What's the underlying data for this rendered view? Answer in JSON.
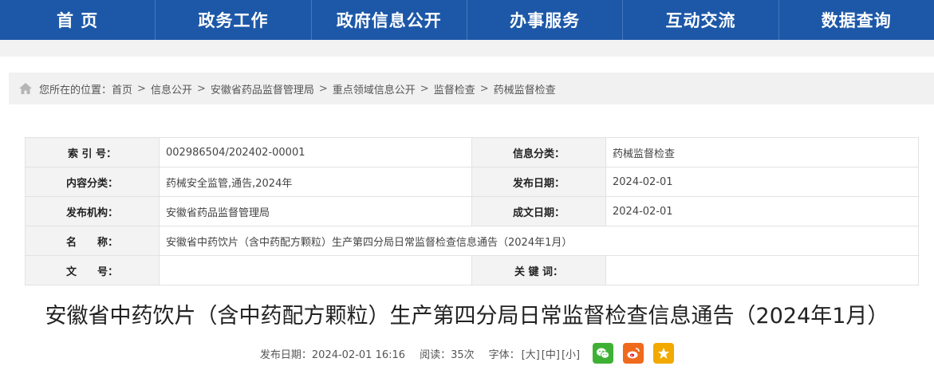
{
  "nav": {
    "items": [
      "首 页",
      "政务工作",
      "政府信息公开",
      "办事服务",
      "互动交流",
      "数据查询"
    ]
  },
  "breadcrumb": {
    "prefix": "您所在的位置：",
    "items": [
      "首页",
      "信息公开",
      "安徽省药品监督管理局",
      "重点领域信息公开",
      "监督检查",
      "药械监督检查"
    ],
    "separator": ">"
  },
  "meta": {
    "index_label": "索 引 号：",
    "index_value": "002986504/202402-00001",
    "category_label": "信息分类：",
    "category_value": "药械监督检查",
    "content_type_label": "内容分类：",
    "content_type_value": "药械安全监管,通告,2024年",
    "publish_date_label": "发布日期：",
    "publish_date_value": "2024-02-01",
    "publisher_label": "发布机构：",
    "publisher_value": "安徽省药品监督管理局",
    "created_date_label": "成文日期：",
    "created_date_value": "2024-02-01",
    "name_label": "名　　称：",
    "name_value": "安徽省中药饮片（含中药配方颗粒）生产第四分局日常监督检查信息通告（2024年1月）",
    "doc_no_label": "文　　号：",
    "doc_no_value": "",
    "keywords_label": "关 键 词：",
    "keywords_value": ""
  },
  "article": {
    "title": "安徽省中药饮片（含中药配方颗粒）生产第四分局日常监督检查信息通告（2024年1月）",
    "publish": "发布日期：2024-02-01 16:16",
    "reads": "阅读：35次",
    "font_label": "字体：",
    "font_large": "[大]",
    "font_medium": "[中]",
    "font_small": "[小]"
  },
  "share_icons": [
    "wechat-icon",
    "weibo-icon",
    "favorite-icon"
  ],
  "colors": {
    "nav_bg": "#1d58a8",
    "wechat": "#3eb135",
    "weibo": "#e6162d",
    "favorite": "#f2a900"
  }
}
